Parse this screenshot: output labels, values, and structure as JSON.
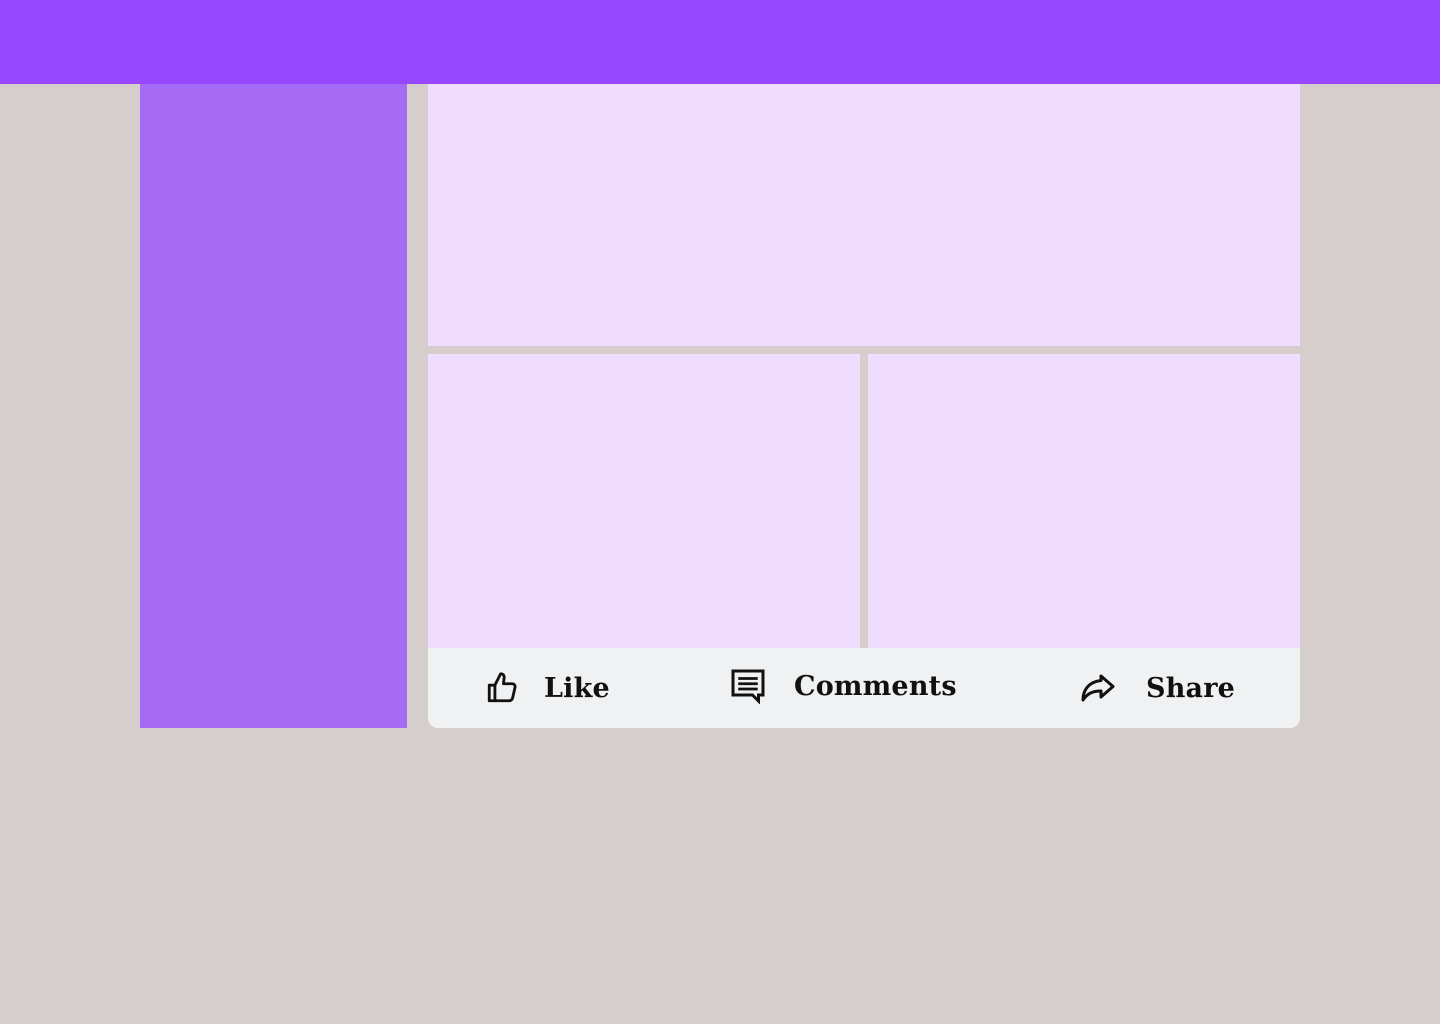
{
  "post": {
    "actions": {
      "like_label": "Like",
      "comments_label": "Comments",
      "share_label": "Share"
    }
  },
  "icons": {
    "like": "thumbs-up-icon",
    "comments": "comment-icon",
    "share": "share-arrow-icon"
  },
  "colors": {
    "topbar": "#9748ff",
    "sidebar": "#a66bf5",
    "media": "#f0dcff",
    "action_bar": "#f0f1f3",
    "page_background": "#d6cdcd"
  }
}
